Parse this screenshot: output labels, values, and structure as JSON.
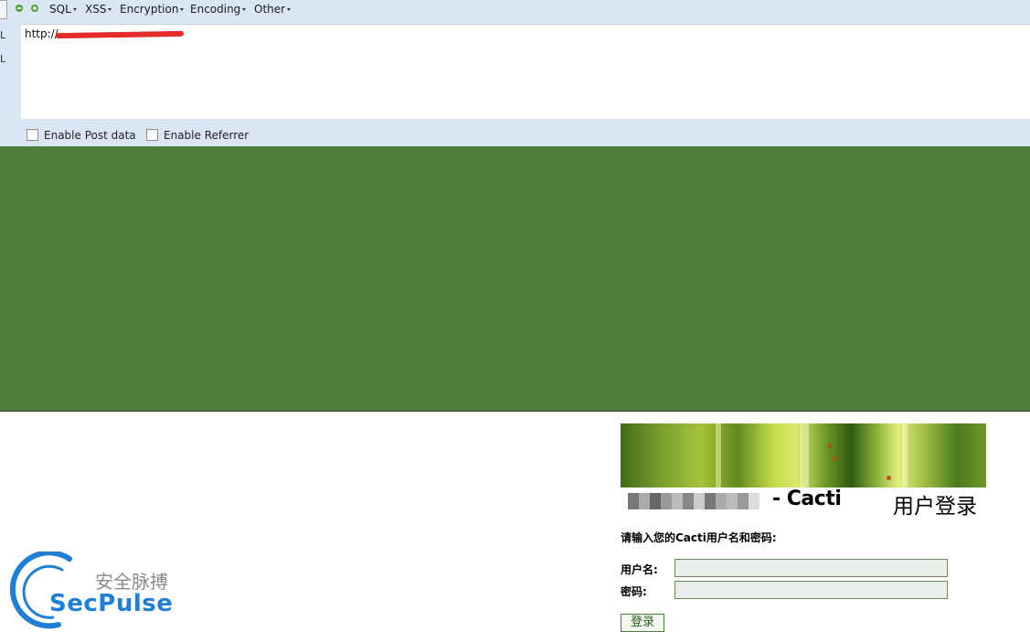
{
  "hackbar": {
    "menus": [
      "SQL",
      "XSS",
      "Encryption",
      "Encoding",
      "Other"
    ],
    "side_labels": [
      "L",
      "L"
    ],
    "url_value": "http://",
    "options": [
      "Enable Post data",
      "Enable Referrer"
    ]
  },
  "page": {
    "background_color": "#4f7f3e",
    "cacti_title": "- Cacti",
    "login_title": "用户登录",
    "prompt": "请输入您的Cacti用户名和密码:",
    "username_label": "用户名:",
    "password_label": "密码:",
    "username_value": "",
    "password_value": "",
    "login_button": "登录"
  },
  "watermark": {
    "chinese_text": "安全脉搏",
    "brand": "SecPulse",
    "brand_color": "#1f7fd6"
  }
}
